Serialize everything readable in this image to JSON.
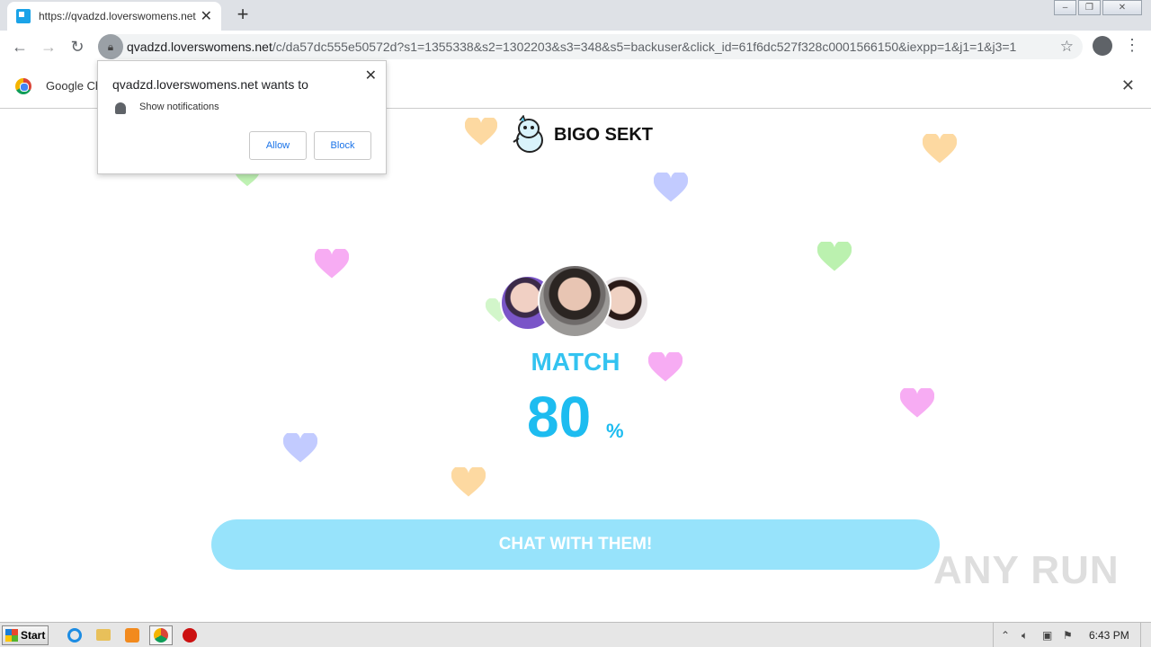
{
  "browser": {
    "tab_title": "https://qvadzd.loverswomens.net/c/",
    "url_host": "qvadzd.loverswomens.net",
    "url_rest": "/c/da57dc555e50572d?s1=1355338&s2=1302203&s3=348&s5=backuser&click_id=61f6dc527f328c0001566150&iexpp=1&j1=1&j3=1",
    "infobar_text": "Google Ch"
  },
  "notification_popup": {
    "title": "qvadzd.loverswomens.net wants to",
    "item": "Show notifications",
    "allow": "Allow",
    "block": "Block"
  },
  "page": {
    "brand": "BIGO SEKT",
    "match_label": "MATCH",
    "match_value": "80",
    "match_unit": "%",
    "cta": "CHAT WITH THEM!",
    "watermark": "ANY RUN"
  },
  "taskbar": {
    "start": "Start",
    "clock": "6:43 PM"
  },
  "colors": {
    "accent": "#1dbcf0",
    "cta_bg": "#97e3fb",
    "heart_orange": "#fdd08a",
    "heart_blue": "#b7c2ff",
    "heart_green": "#b4f0a6",
    "heart_pink": "#f6a3f2"
  }
}
